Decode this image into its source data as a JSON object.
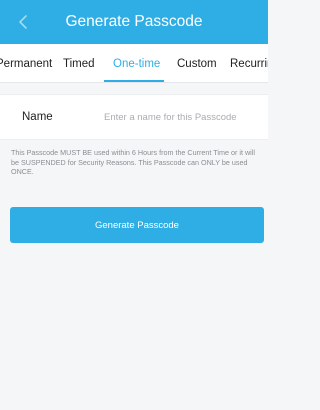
{
  "header": {
    "title": "Generate Passcode",
    "back_icon": "chevron-left-icon",
    "background_color": "#2eaee4"
  },
  "tabs": [
    {
      "label": "Permanent",
      "active": false
    },
    {
      "label": "Timed",
      "active": false
    },
    {
      "label": "One-time",
      "active": true
    },
    {
      "label": "Custom",
      "active": false
    },
    {
      "label": "Recurring",
      "active": false
    }
  ],
  "form": {
    "name_label": "Name",
    "name_value": "",
    "name_placeholder": "Enter a name for this Passcode"
  },
  "notice": "This Passcode MUST BE used within 6 Hours from the Current Time or it will be SUSPENDED for Security Reasons. This Passcode can ONLY be used ONCE.",
  "actions": {
    "generate_label": "Generate Passcode"
  },
  "colors": {
    "accent": "#2eaee4",
    "background": "#f5f6f8"
  }
}
